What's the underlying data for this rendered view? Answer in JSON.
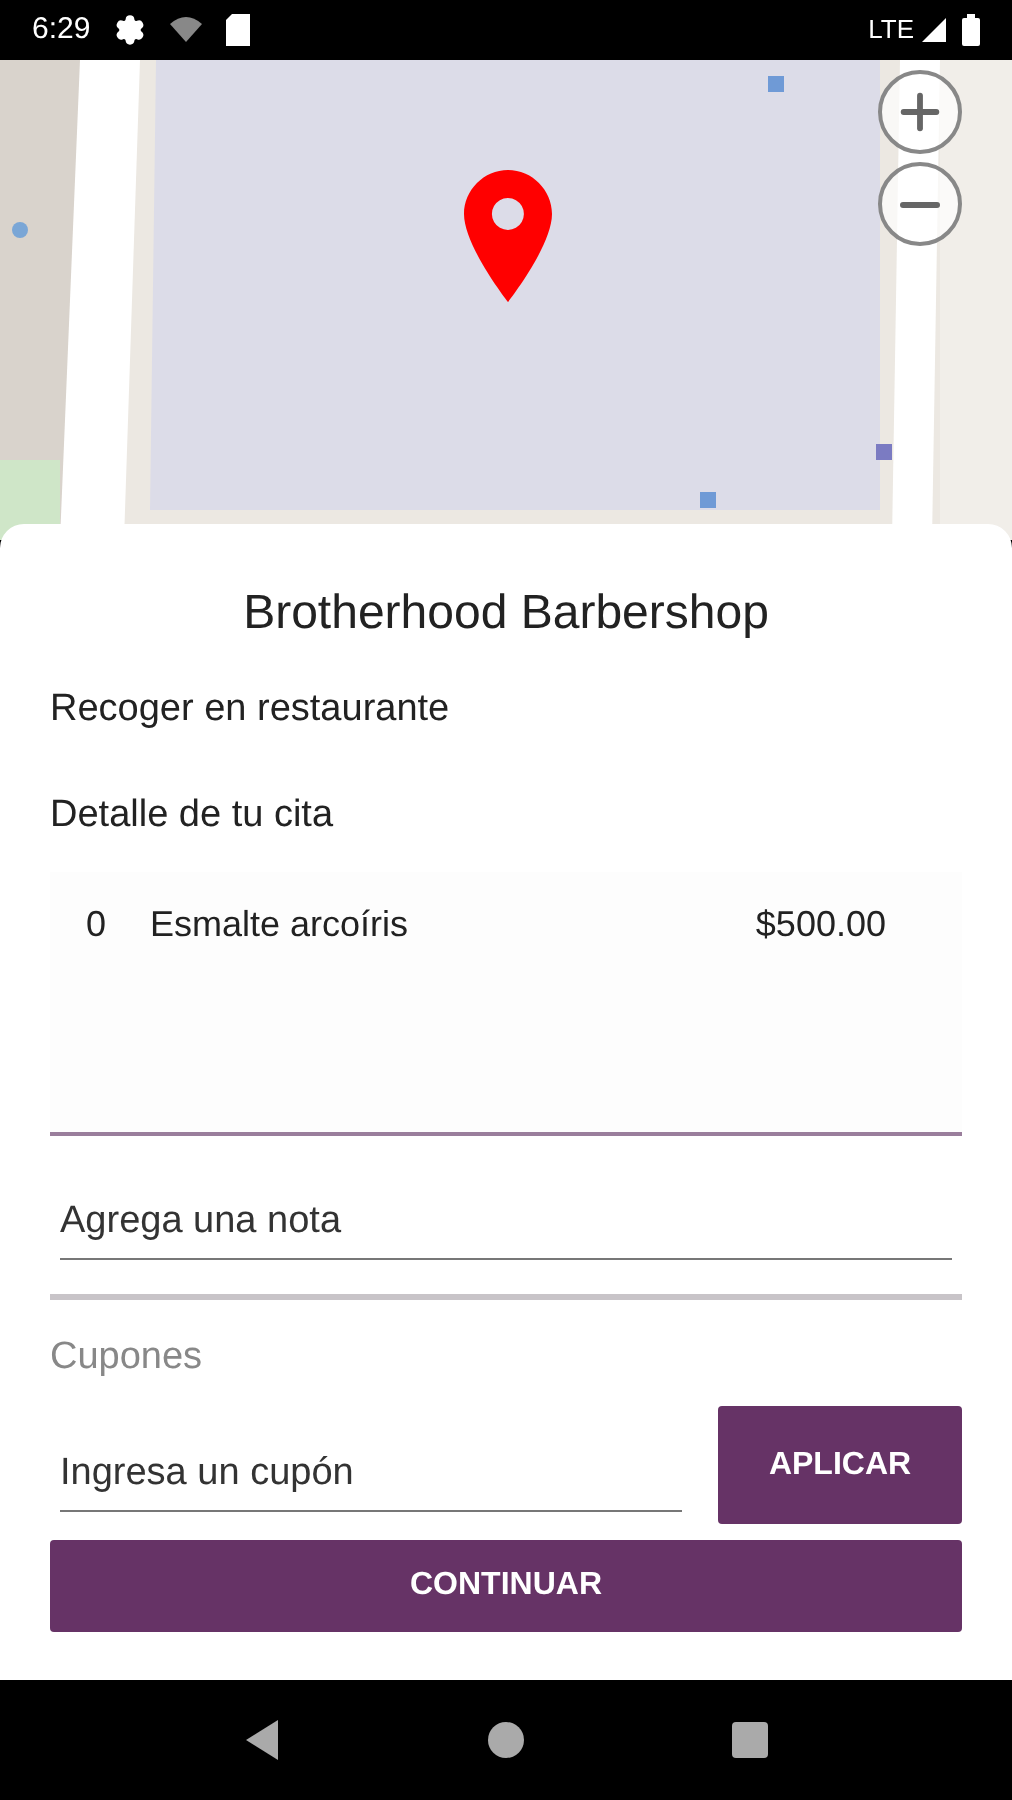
{
  "status_bar": {
    "time": "6:29",
    "network": "LTE"
  },
  "sheet": {
    "title": "Brotherhood Barbershop",
    "pickup": "Recoger en restaurante",
    "detail_heading": "Detalle de tu cita",
    "items": [
      {
        "quantity": "0",
        "name": "Esmalte arcoíris",
        "price": "$500.00"
      }
    ],
    "note": {
      "placeholder": "Agrega una nota"
    },
    "coupons_label": "Cupones",
    "coupon": {
      "placeholder": "Ingresa un cupón"
    },
    "apply_button": "APLICAR",
    "continue_button": "CONTINUAR"
  }
}
